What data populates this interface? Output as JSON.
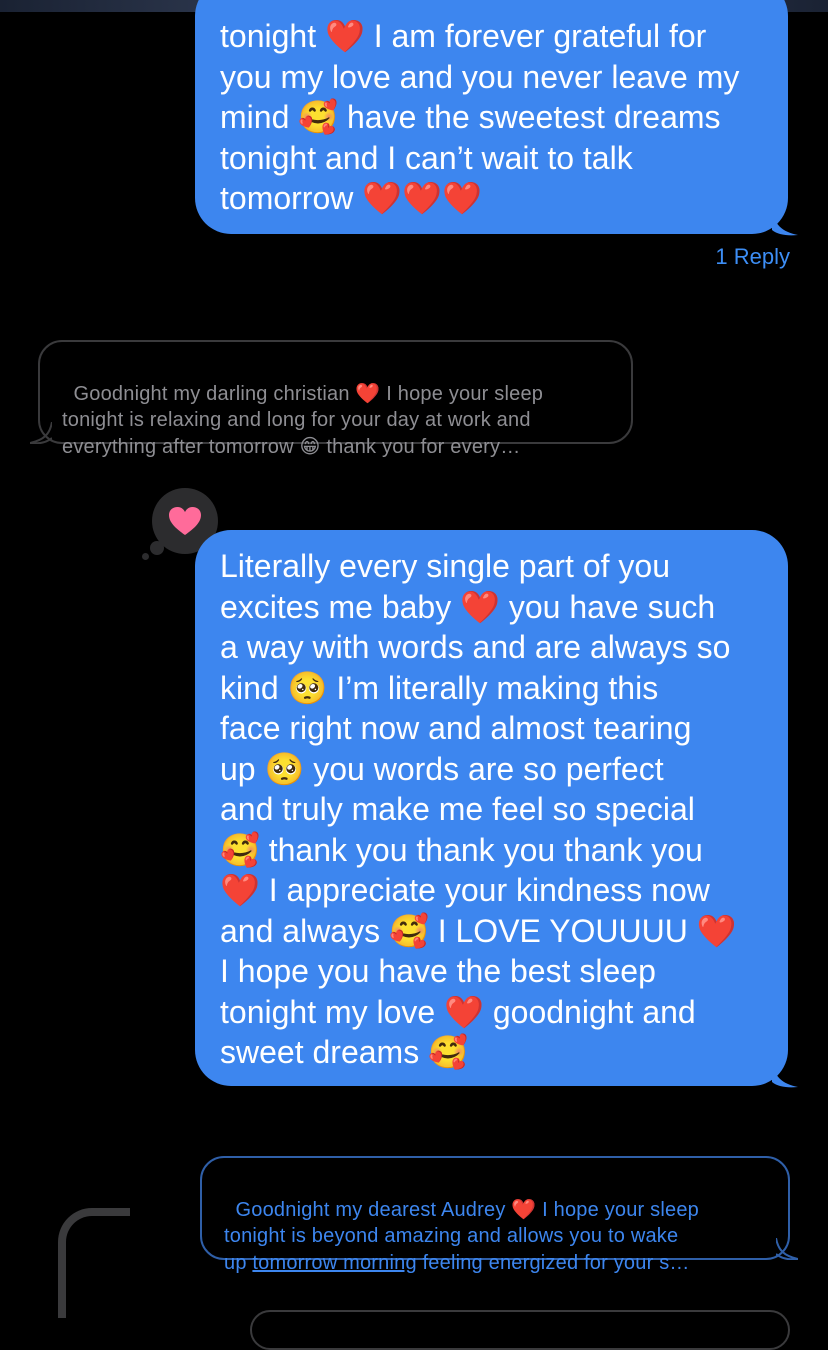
{
  "messages": [
    {
      "direction": "outgoing",
      "text": "tonight ❤️ I am forever grateful for\nyou my love and you never leave my\nmind 🥰 have the sweetest dreams\ntonight and I can’t wait to talk\ntomorrow ❤️❤️❤️",
      "reply_count": "1 Reply"
    },
    {
      "direction": "quoted-incoming",
      "text": "Goodnight my darling christian ❤️ I hope your sleep\ntonight is relaxing and long for your day at work and\neverything after tomorrow 😁 thank you for every…"
    },
    {
      "direction": "outgoing",
      "reaction": "heart",
      "text": "Literally every single part of you\nexcites me baby ❤️ you have such\na way with words and are always so\nkind 🥺 I’m literally making this\nface right now and almost tearing\nup 🥺 you words are so perfect\nand truly make me feel so special\n🥰 thank you thank you thank you\n❤️ I appreciate your kindness now\nand always 🥰 I LOVE YOUUUU ❤️\nI hope you have the best sleep\ntonight my love ❤️ goodnight and\nsweet dreams 🥰"
    },
    {
      "direction": "quoted-outgoing",
      "text_before_link": "Goodnight my dearest Audrey ❤️ I hope your sleep\ntonight is beyond amazing and allows you to wake\nup ",
      "link_text": "tomorrow morning",
      "text_after_link": " feeling energized for your s…"
    }
  ],
  "colors": {
    "background": "#000000",
    "outgoing_bubble": "#3d86ef",
    "reply_link": "#3d8ef5",
    "quoted_gray": "#8e8e93",
    "reaction_bg": "#2c2c2e",
    "reaction_heart": "#ff6b9a"
  }
}
